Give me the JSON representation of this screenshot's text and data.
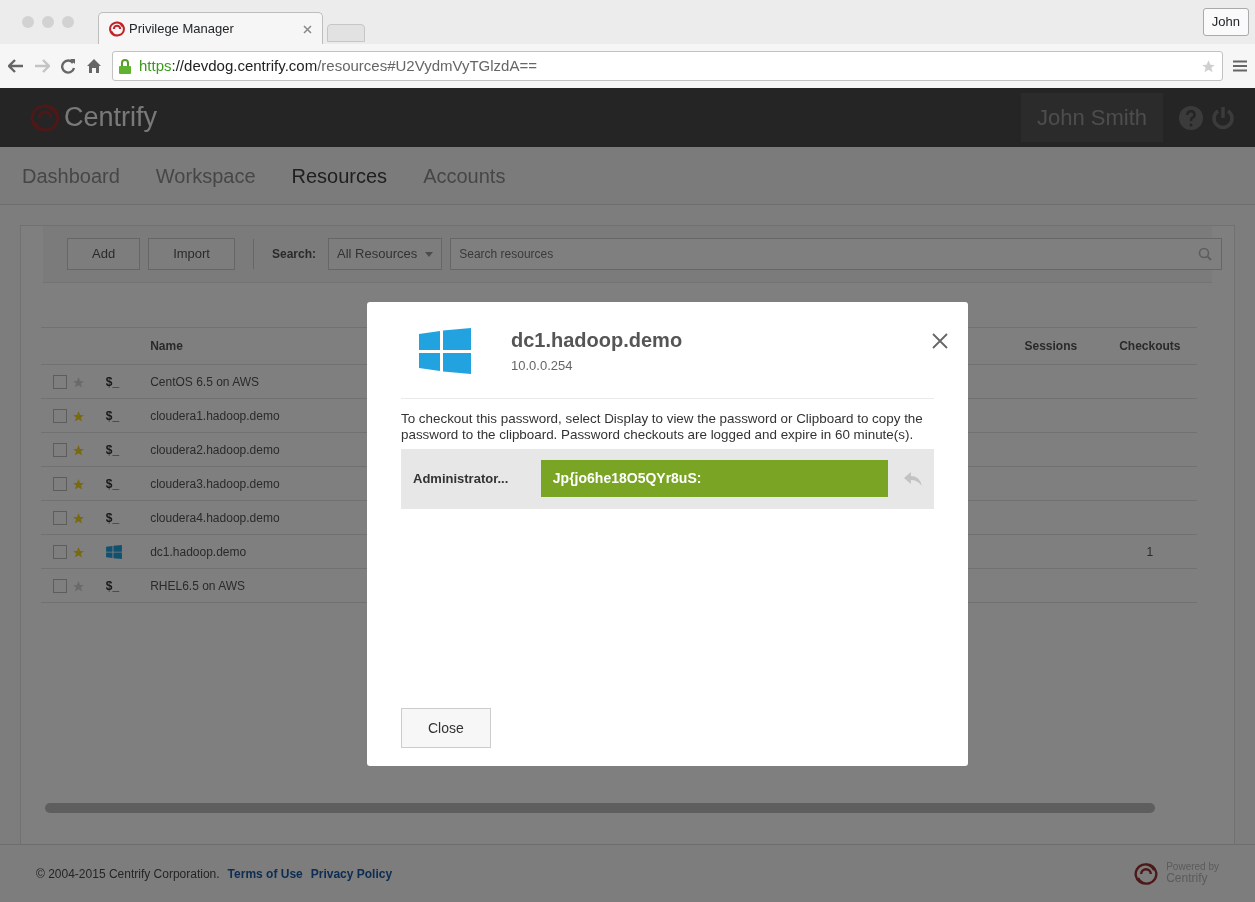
{
  "browser": {
    "tab_title": "Privilege Manager",
    "url": {
      "scheme": "https",
      "host": "://devdog.centrify.com",
      "path": "/resources#U2VydmVyTGlzdA=="
    },
    "profile": "John"
  },
  "header": {
    "logo": "Centrify",
    "user": "John Smith"
  },
  "tabs": [
    {
      "label": "Dashboard",
      "selected": false
    },
    {
      "label": "Workspace",
      "selected": false
    },
    {
      "label": "Resources",
      "selected": true
    },
    {
      "label": "Accounts",
      "selected": false
    }
  ],
  "toolbar": {
    "buttons": [
      "Add",
      "Import"
    ],
    "search_label": "Search:",
    "scope": "All Resources",
    "placeholder": "Search resources"
  },
  "table": {
    "columns": [
      {
        "label": "Name"
      },
      {
        "label": "Sessions"
      },
      {
        "label": "Checkouts"
      }
    ],
    "rows": [
      {
        "checked": false,
        "favorite": false,
        "kind": "terminal",
        "glyph": "$_",
        "name": "CentOS 6.5 on AWS"
      },
      {
        "checked": false,
        "favorite": true,
        "kind": "terminal",
        "glyph": "$_",
        "name": "cloudera1.hadoop.demo"
      },
      {
        "checked": false,
        "favorite": true,
        "kind": "terminal",
        "glyph": "$_",
        "name": "cloudera2.hadoop.demo"
      },
      {
        "checked": false,
        "favorite": true,
        "kind": "terminal",
        "glyph": "$_",
        "name": "cloudera3.hadoop.demo"
      },
      {
        "checked": false,
        "favorite": true,
        "kind": "terminal",
        "glyph": "$_",
        "name": "cloudera4.hadoop.demo"
      },
      {
        "checked": false,
        "favorite": true,
        "kind": "windows",
        "name": "dc1.hadoop.demo",
        "checkouts": "1"
      },
      {
        "checked": false,
        "favorite": false,
        "kind": "terminal",
        "glyph": "$_",
        "name": "RHEL6.5 on AWS"
      }
    ]
  },
  "footer": {
    "copyright": "© 2004-2015 Centrify Corporation.",
    "links": [
      "Terms of Use",
      "Privacy Policy"
    ],
    "powered_by": "Powered by",
    "brand": "Centrify"
  },
  "modal": {
    "title": "dc1.hadoop.demo",
    "address": "10.0.0.254",
    "message": "To checkout this password, select Display to view the password or Clipboard to copy the password to the clipboard. Password checkouts are logged and expire in 60 minute(s).",
    "account": "Administrator...",
    "password": "Jp{jo6he18O5QYr8uS:",
    "close_button": "Close"
  }
}
